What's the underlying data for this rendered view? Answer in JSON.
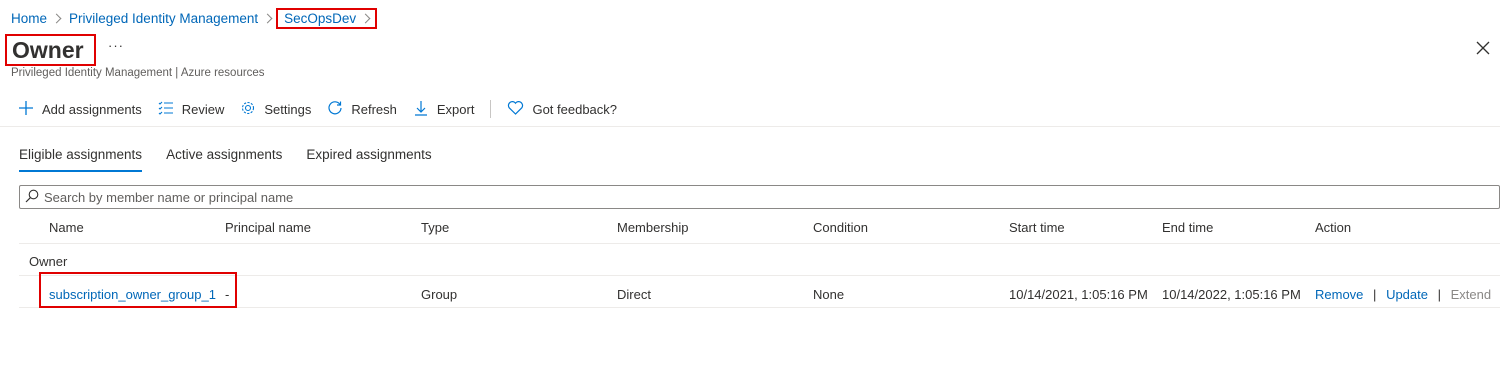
{
  "breadcrumb": {
    "items": [
      "Home",
      "Privileged Identity Management"
    ],
    "current": "SecOpsDev"
  },
  "header": {
    "title": "Owner",
    "more_label": "···",
    "subtitle": "Privileged Identity Management | Azure resources"
  },
  "toolbar": {
    "add": "Add assignments",
    "review": "Review",
    "settings": "Settings",
    "refresh": "Refresh",
    "export": "Export",
    "feedback": "Got feedback?"
  },
  "tabs": [
    "Eligible assignments",
    "Active assignments",
    "Expired assignments"
  ],
  "search": {
    "placeholder": "Search by member name or principal name"
  },
  "table": {
    "columns": [
      "Name",
      "Principal name",
      "Type",
      "Membership",
      "Condition",
      "Start time",
      "End time",
      "Action"
    ],
    "group": "Owner",
    "rows": [
      {
        "name": "subscription_owner_group_1",
        "principal": "-",
        "type": "Group",
        "membership": "Direct",
        "condition": "None",
        "start": "10/14/2021, 1:05:16 PM",
        "end": "10/14/2022, 1:05:16 PM",
        "actions": {
          "remove": "Remove",
          "sep": "|",
          "update": "Update",
          "extend": "Extend"
        }
      }
    ]
  },
  "colors": {
    "accent": "#0078d4",
    "link": "#0067b8",
    "highlight": "#e00000"
  }
}
